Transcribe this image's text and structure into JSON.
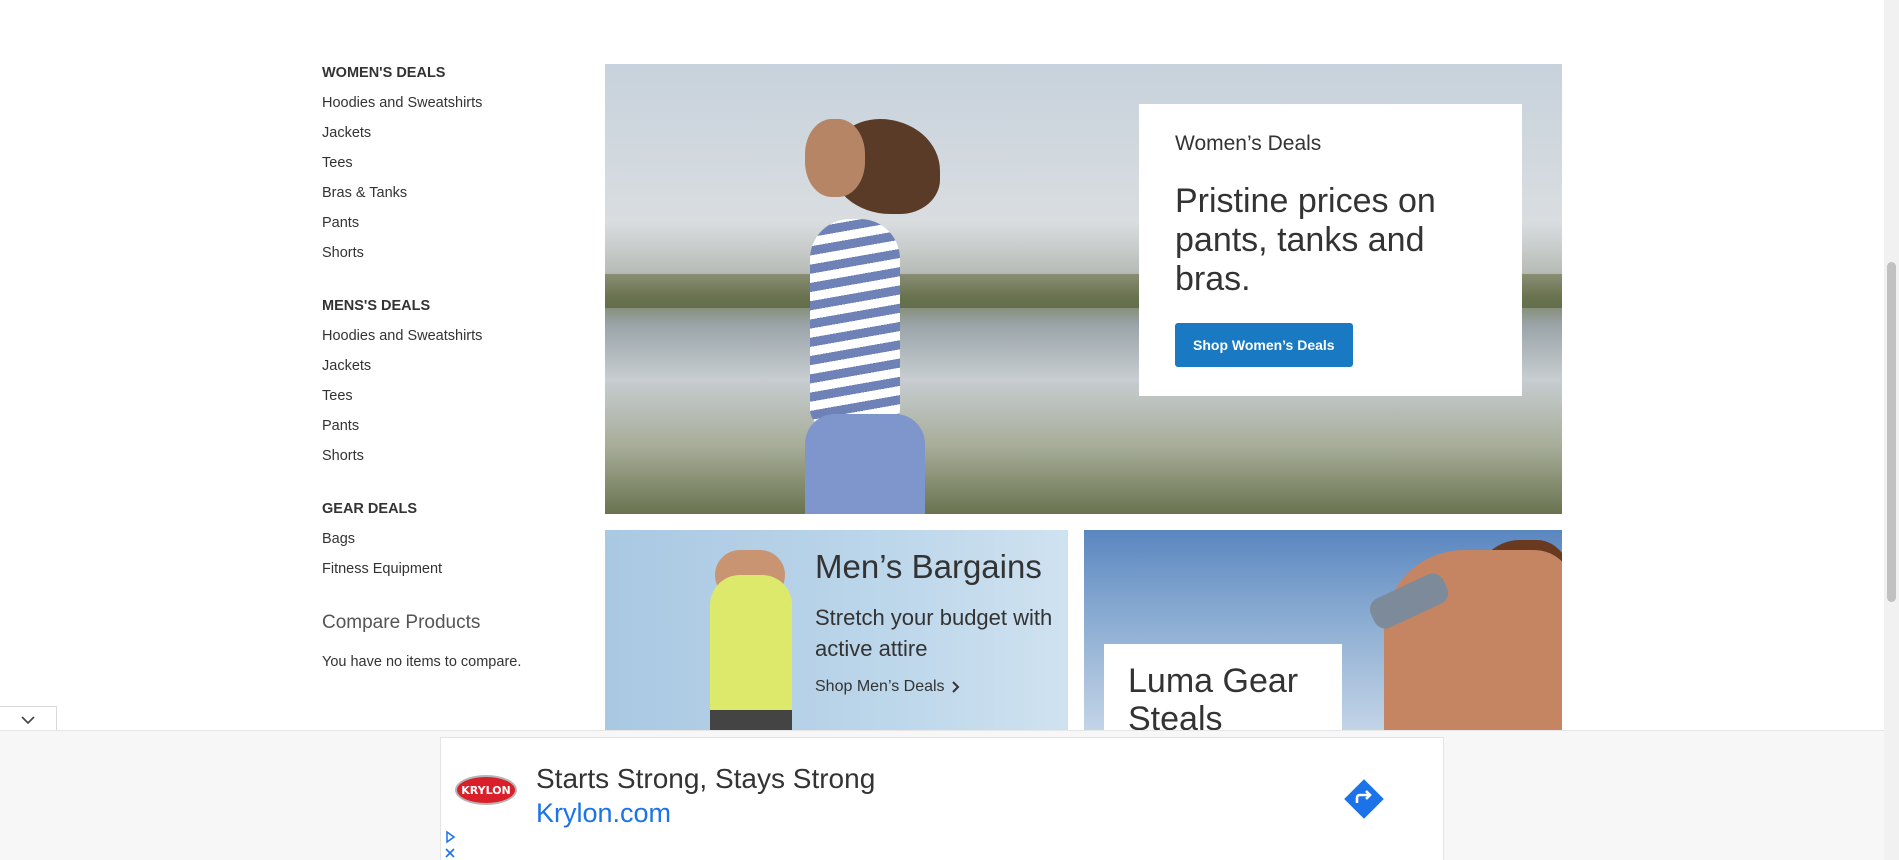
{
  "sidebar": {
    "groups": [
      {
        "title": "WOMEN'S DEALS",
        "items": [
          "Hoodies and Sweatshirts",
          "Jackets",
          "Tees",
          "Bras & Tanks",
          "Pants",
          "Shorts"
        ]
      },
      {
        "title": "MENS'S DEALS",
        "items": [
          "Hoodies and Sweatshirts",
          "Jackets",
          "Tees",
          "Pants",
          "Shorts"
        ]
      },
      {
        "title": "GEAR DEALS",
        "items": [
          "Bags",
          "Fitness Equipment"
        ]
      }
    ],
    "compare": {
      "title": "Compare Products",
      "empty_text": "You have no items to compare."
    }
  },
  "hero": {
    "kicker": "Women’s Deals",
    "title": "Pristine prices on pants, tanks and bras.",
    "button_label": "Shop Women’s Deals",
    "button_color": "#1979c3"
  },
  "mens": {
    "title": "Men’s Bargains",
    "text": "Stretch your budget with active attire",
    "link_label": "Shop Men’s Deals"
  },
  "gear": {
    "title": "Luma Gear Steals"
  },
  "ad": {
    "logo_text": "KRYLON",
    "headline": "Starts Strong, Stays Strong",
    "domain": "Krylon.com",
    "cta_icon": "arrow-right-icon",
    "cta_color": "#1a73e8",
    "choices_icon": "ad-choices-icon",
    "close_icon": "close-icon"
  },
  "collapse_icon": "chevron-down-icon"
}
